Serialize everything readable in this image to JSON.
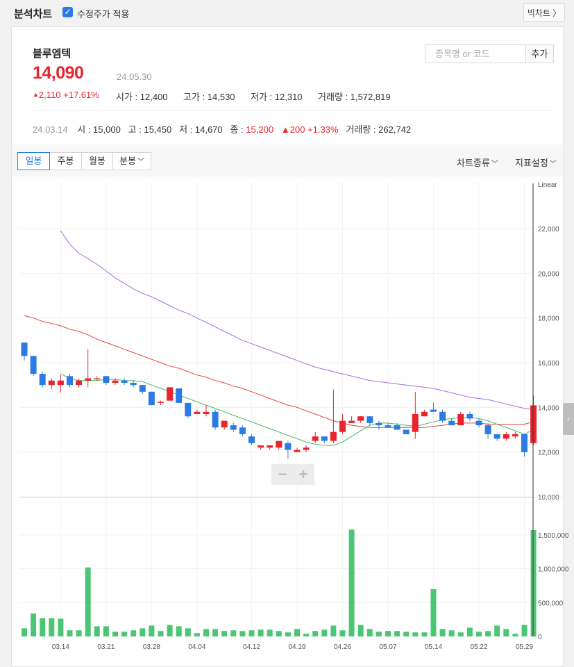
{
  "topbar": {
    "title": "분석차트",
    "checkbox_label": "수정주가 적용",
    "checkbox_checked": true,
    "big_chart_label": "빅차트 〉"
  },
  "stock": {
    "name": "블루엠텍",
    "price": "14,090",
    "date": "24.05.30",
    "change": "2,110",
    "change_rate": "+17.61%",
    "open_label": "시가",
    "open": "12,400",
    "high_label": "고가",
    "high": "14,530",
    "low_label": "저가",
    "low": "12,310",
    "volume_label": "거래량",
    "volume": "1,572,819",
    "up_color": "#e8252c",
    "down_color": "#2c7be5"
  },
  "search": {
    "placeholder": "종목명 or 코드",
    "add_label": "추가"
  },
  "prev_day": {
    "date": "24.03.14",
    "open_label": "시",
    "open": "15,000",
    "high_label": "고",
    "high": "15,450",
    "low_label": "저",
    "low": "14,670",
    "close_label": "종",
    "close": "15,200",
    "change": "200",
    "change_rate": "+1.33%",
    "volume_label": "거래량",
    "volume": "262,742"
  },
  "toolbar": {
    "tabs": [
      {
        "label": "일봉",
        "active": true
      },
      {
        "label": "주봉",
        "active": false
      },
      {
        "label": "월봉",
        "active": false
      },
      {
        "label": "분봉",
        "active": false,
        "dropdown": true
      }
    ],
    "chart_type_label": "차트종류",
    "indicator_label": "지표설정"
  },
  "chart_data": {
    "type": "candlestick",
    "scale_label": "Linear",
    "price_axis": {
      "min": 10000,
      "max": 22000,
      "ticks": [
        "22,000",
        "20,000",
        "18,000",
        "16,000",
        "14,000",
        "12,000",
        "10,000"
      ]
    },
    "volume_axis": {
      "max": 1500000,
      "ticks": [
        "1,500,000",
        "1,000,000",
        "500,000",
        "0"
      ]
    },
    "x_tick_labels": [
      "03.14",
      "03.21",
      "03.28",
      "04.04",
      "04.12",
      "04.19",
      "04.26",
      "05.07",
      "05.14",
      "05.22",
      "05.29"
    ],
    "candles": [
      {
        "o": 16900,
        "h": 16900,
        "l": 16100,
        "c": 16300
      },
      {
        "o": 16300,
        "h": 16300,
        "l": 15400,
        "c": 15500
      },
      {
        "o": 15500,
        "h": 15600,
        "l": 14900,
        "c": 15000
      },
      {
        "o": 15000,
        "h": 15300,
        "l": 14800,
        "c": 15200
      },
      {
        "o": 15000,
        "h": 15450,
        "l": 14670,
        "c": 15200
      },
      {
        "o": 15400,
        "h": 15500,
        "l": 14900,
        "c": 15000
      },
      {
        "o": 15000,
        "h": 15300,
        "l": 14900,
        "c": 15200
      },
      {
        "o": 15200,
        "h": 16600,
        "l": 14900,
        "c": 15300
      },
      {
        "o": 15300,
        "h": 15400,
        "l": 15200,
        "c": 15300
      },
      {
        "o": 15400,
        "h": 15400,
        "l": 15000,
        "c": 15100
      },
      {
        "o": 15100,
        "h": 15300,
        "l": 15000,
        "c": 15200
      },
      {
        "o": 15200,
        "h": 15300,
        "l": 15000,
        "c": 15100
      },
      {
        "o": 15100,
        "h": 15200,
        "l": 14900,
        "c": 15000
      },
      {
        "o": 15000,
        "h": 15000,
        "l": 14600,
        "c": 14700
      },
      {
        "o": 14700,
        "h": 14700,
        "l": 14100,
        "c": 14100
      },
      {
        "o": 14200,
        "h": 14300,
        "l": 14100,
        "c": 14250
      },
      {
        "o": 14300,
        "h": 14900,
        "l": 14300,
        "c": 14900
      },
      {
        "o": 14850,
        "h": 14850,
        "l": 14200,
        "c": 14200
      },
      {
        "o": 14200,
        "h": 14200,
        "l": 13500,
        "c": 13600
      },
      {
        "o": 13700,
        "h": 13900,
        "l": 13700,
        "c": 13800
      },
      {
        "o": 13700,
        "h": 14100,
        "l": 13600,
        "c": 13800
      },
      {
        "o": 13800,
        "h": 13900,
        "l": 13000,
        "c": 13100
      },
      {
        "o": 13100,
        "h": 13400,
        "l": 13000,
        "c": 13400
      },
      {
        "o": 13200,
        "h": 13300,
        "l": 12900,
        "c": 13000
      },
      {
        "o": 13100,
        "h": 13200,
        "l": 12700,
        "c": 12800
      },
      {
        "o": 12700,
        "h": 12800,
        "l": 12300,
        "c": 12400
      },
      {
        "o": 12200,
        "h": 12300,
        "l": 12100,
        "c": 12300
      },
      {
        "o": 12200,
        "h": 12300,
        "l": 12100,
        "c": 12300
      },
      {
        "o": 12200,
        "h": 12500,
        "l": 12100,
        "c": 12500
      },
      {
        "o": 12400,
        "h": 12500,
        "l": 11700,
        "c": 12100
      },
      {
        "o": 12000,
        "h": 12200,
        "l": 12000,
        "c": 12100
      },
      {
        "o": 12100,
        "h": 12300,
        "l": 12000,
        "c": 12200
      },
      {
        "o": 12500,
        "h": 12900,
        "l": 12400,
        "c": 12700
      },
      {
        "o": 12700,
        "h": 12700,
        "l": 12400,
        "c": 12500
      },
      {
        "o": 12500,
        "h": 14800,
        "l": 12400,
        "c": 12900
      },
      {
        "o": 12900,
        "h": 13700,
        "l": 12800,
        "c": 13400
      },
      {
        "o": 13300,
        "h": 13600,
        "l": 13300,
        "c": 13400
      },
      {
        "o": 13400,
        "h": 13600,
        "l": 13300,
        "c": 13600
      },
      {
        "o": 13600,
        "h": 13600,
        "l": 13200,
        "c": 13300
      },
      {
        "o": 13300,
        "h": 13400,
        "l": 13000,
        "c": 13200
      },
      {
        "o": 13200,
        "h": 13300,
        "l": 13100,
        "c": 13100
      },
      {
        "o": 13200,
        "h": 13300,
        "l": 13000,
        "c": 13000
      },
      {
        "o": 13000,
        "h": 13000,
        "l": 12800,
        "c": 12800
      },
      {
        "o": 12900,
        "h": 14700,
        "l": 12600,
        "c": 13700
      },
      {
        "o": 13600,
        "h": 13900,
        "l": 13600,
        "c": 13800
      },
      {
        "o": 13900,
        "h": 14200,
        "l": 13800,
        "c": 13800
      },
      {
        "o": 13800,
        "h": 13900,
        "l": 13300,
        "c": 13400
      },
      {
        "o": 13400,
        "h": 13500,
        "l": 13200,
        "c": 13200
      },
      {
        "o": 13200,
        "h": 13800,
        "l": 13200,
        "c": 13700
      },
      {
        "o": 13700,
        "h": 13800,
        "l": 13400,
        "c": 13500
      },
      {
        "o": 13400,
        "h": 13500,
        "l": 13100,
        "c": 13200
      },
      {
        "o": 13200,
        "h": 13300,
        "l": 12600,
        "c": 12800
      },
      {
        "o": 12800,
        "h": 12800,
        "l": 12500,
        "c": 12600
      },
      {
        "o": 12600,
        "h": 12900,
        "l": 12500,
        "c": 12800
      },
      {
        "o": 12700,
        "h": 12900,
        "l": 12600,
        "c": 12800
      },
      {
        "o": 12800,
        "h": 12800,
        "l": 11800,
        "c": 12000
      },
      {
        "o": 12400,
        "h": 14530,
        "l": 12310,
        "c": 14090
      }
    ],
    "volumes": [
      120000,
      340000,
      270000,
      270000,
      262742,
      90000,
      90000,
      1020000,
      150000,
      150000,
      70000,
      70000,
      90000,
      120000,
      160000,
      80000,
      170000,
      150000,
      120000,
      50000,
      110000,
      110000,
      80000,
      90000,
      80000,
      90000,
      100000,
      100000,
      80000,
      60000,
      110000,
      40000,
      80000,
      100000,
      160000,
      90000,
      1580000,
      170000,
      110000,
      70000,
      80000,
      80000,
      70000,
      60000,
      60000,
      700000,
      110000,
      90000,
      60000,
      130000,
      70000,
      80000,
      160000,
      110000,
      40000,
      170000,
      1572819
    ],
    "ma5": [
      null,
      null,
      null,
      null,
      15500,
      15300,
      15200,
      15200,
      15200,
      15250,
      15250,
      15200,
      15200,
      15150,
      15000,
      14850,
      14700,
      14550,
      14400,
      14250,
      14100,
      13950,
      13800,
      13650,
      13500,
      13350,
      13200,
      13050,
      12900,
      12750,
      12600,
      12450,
      12350,
      12300,
      12300,
      12450,
      12700,
      12950,
      13200,
      13300,
      13300,
      13250,
      13200,
      13150,
      13250,
      13350,
      13450,
      13500,
      13550,
      13550,
      13500,
      13400,
      13250,
      13100,
      12950,
      12800,
      13000
    ],
    "ma20": [
      18100,
      18000,
      17850,
      17750,
      17650,
      17500,
      17400,
      17250,
      17050,
      16900,
      16750,
      16600,
      16450,
      16300,
      16150,
      16000,
      15850,
      15750,
      15600,
      15450,
      15350,
      15200,
      15100,
      14950,
      14850,
      14700,
      14550,
      14400,
      14250,
      14100,
      14000,
      13850,
      13700,
      13550,
      13400,
      13300,
      13200,
      13150,
      13100,
      13100,
      13100,
      13100,
      13100,
      13100,
      13100,
      13150,
      13200,
      13250,
      13300,
      13300,
      13300,
      13250,
      13250,
      13250,
      13250,
      13250,
      13350
    ],
    "ma60": [
      null,
      null,
      null,
      null,
      21900,
      21300,
      20900,
      20650,
      20400,
      20100,
      19800,
      19550,
      19300,
      19100,
      18950,
      18750,
      18550,
      18350,
      18200,
      18000,
      17800,
      17600,
      17400,
      17200,
      17000,
      16850,
      16700,
      16550,
      16400,
      16250,
      16100,
      15950,
      15800,
      15700,
      15600,
      15500,
      15400,
      15300,
      15200,
      15150,
      15100,
      15050,
      15000,
      14950,
      14900,
      14850,
      14750,
      14650,
      14550,
      14450,
      14400,
      14350,
      14250,
      14150,
      14050,
      13950,
      13900
    ],
    "ma_colors": {
      "ma5": "#49b865",
      "ma20": "#e8443b",
      "ma60": "#a76be2"
    },
    "volume_color": "#4cc674",
    "grid": true
  }
}
